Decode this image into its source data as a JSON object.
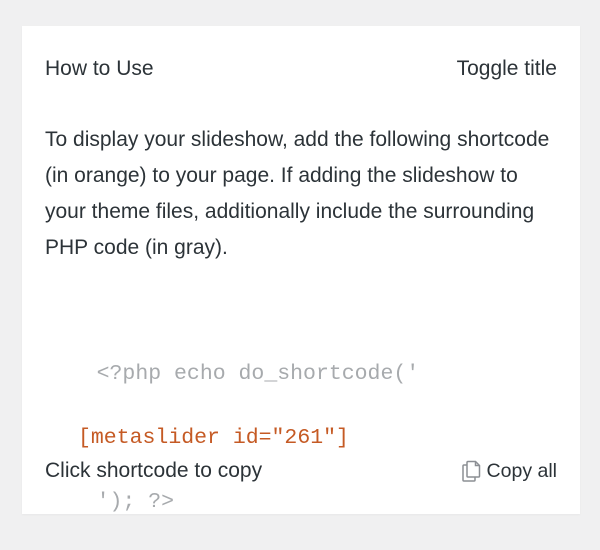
{
  "panel": {
    "title": "How to Use",
    "toggle_label": "Toggle title",
    "instructions": "To display your slideshow, add the following shortcode (in orange) to your page. If adding the slideshow to your theme files, additionally include the surrounding PHP code (in gray).",
    "code": {
      "prefix": "<?php echo do_shortcode('",
      "shortcode": "[metaslider id=\"261\"]",
      "suffix": "'); ?>"
    },
    "footer": {
      "hint": "Click shortcode to copy",
      "copy_all_label": "Copy all",
      "copy_icon": "copy-icon"
    }
  },
  "colors": {
    "background": "#f0f0f1",
    "panel": "#ffffff",
    "text": "#2c3338",
    "code_gray": "#a7aaad",
    "shortcode_orange": "#c55a24"
  }
}
